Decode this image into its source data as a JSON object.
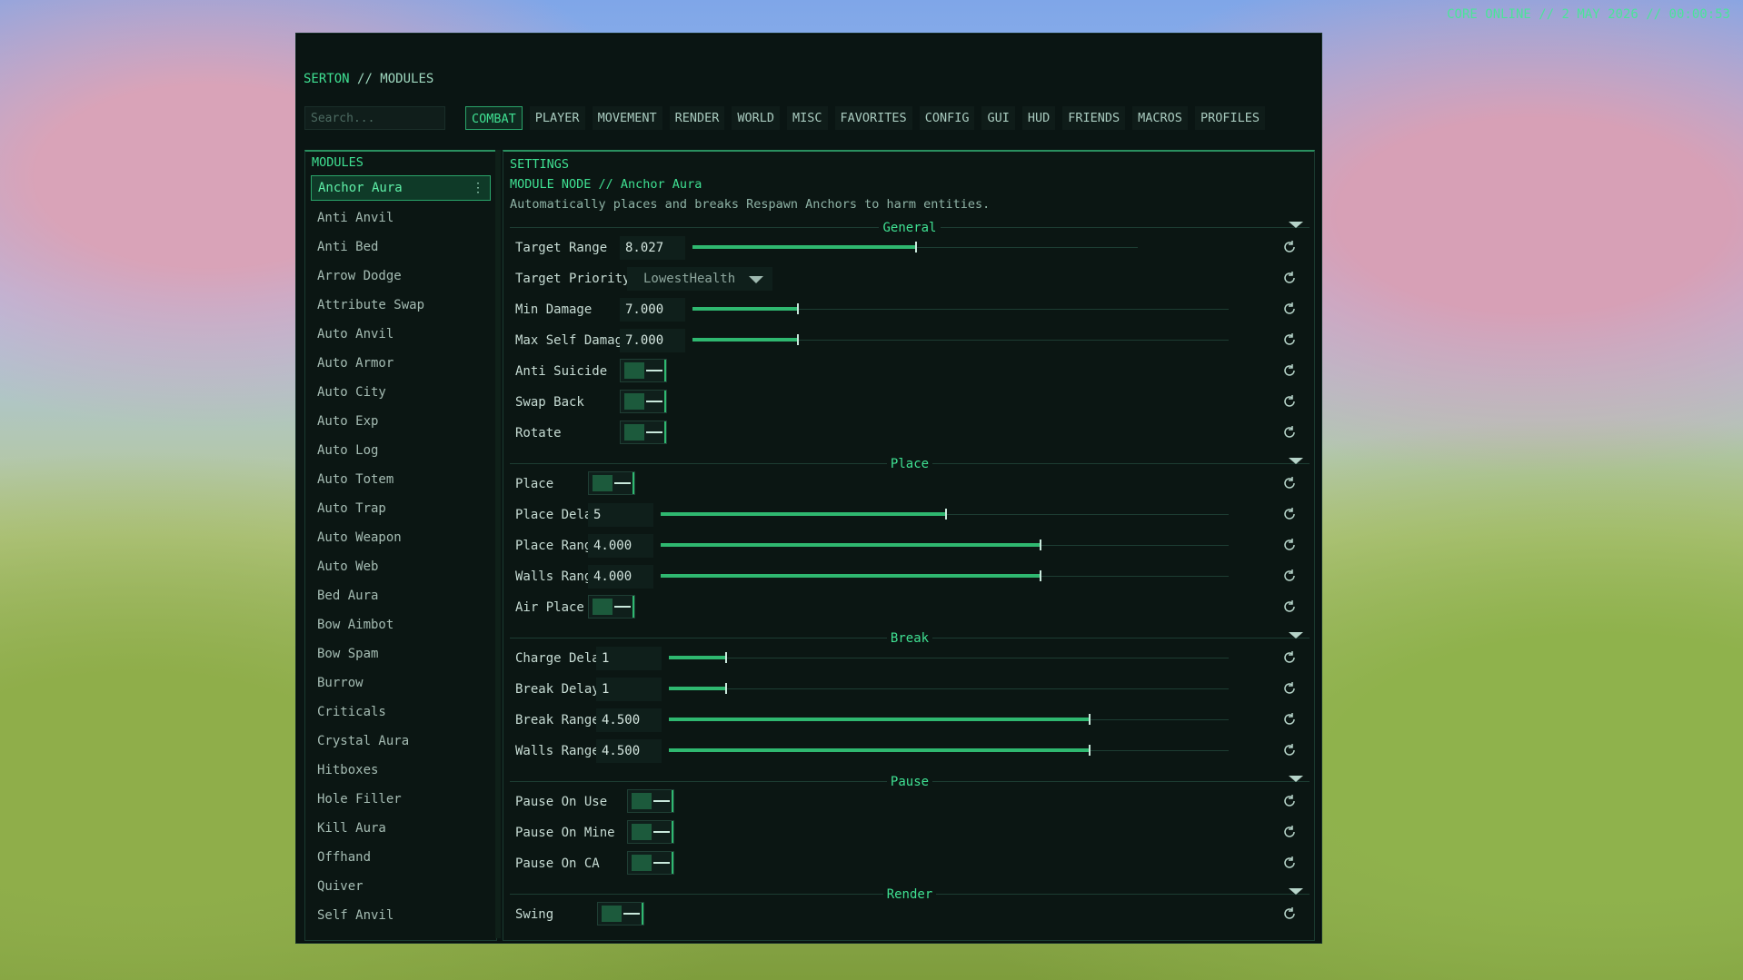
{
  "hud": {
    "status": "CORE ONLINE // 2 MAY 2026 // 00:00:53"
  },
  "window": {
    "brand": "SERTON",
    "title": "// MODULES"
  },
  "search": {
    "placeholder": "Search..."
  },
  "tabs": [
    "COMBAT",
    "PLAYER",
    "MOVEMENT",
    "RENDER",
    "WORLD",
    "MISC",
    "FAVORITES",
    "CONFIG",
    "GUI",
    "HUD",
    "FRIENDS",
    "MACROS",
    "PROFILES"
  ],
  "active_tab": "COMBAT",
  "modules": {
    "header": "MODULES",
    "items": [
      "Anchor Aura",
      "Anti Anvil",
      "Anti Bed",
      "Arrow Dodge",
      "Attribute Swap",
      "Auto Anvil",
      "Auto Armor",
      "Auto City",
      "Auto Exp",
      "Auto Log",
      "Auto Totem",
      "Auto Trap",
      "Auto Weapon",
      "Auto Web",
      "Bed Aura",
      "Bow Aimbot",
      "Bow Spam",
      "Burrow",
      "Criticals",
      "Crystal Aura",
      "Hitboxes",
      "Hole Filler",
      "Kill Aura",
      "Offhand",
      "Quiver",
      "Self Anvil"
    ],
    "more_icon": "⋮"
  },
  "settings": {
    "header": "SETTINGS",
    "node": "MODULE NODE // Anchor Aura",
    "description": "Automatically places and breaks Respawn Anchors to harm entities.",
    "sections": {
      "general": "General",
      "place": "Place",
      "break": "Break",
      "pause": "Pause",
      "render": "Render"
    },
    "general": {
      "target_range": {
        "label": "Target Range",
        "value": "8.027",
        "fraction": 0.5
      },
      "target_priority": {
        "label": "Target Priority",
        "value": "LowestHealth"
      },
      "min_damage": {
        "label": "Min Damage",
        "value": "7.000",
        "fraction": 0.195
      },
      "max_self_damage": {
        "label": "Max Self Damage",
        "value": "7.000",
        "fraction": 0.195
      },
      "anti_suicide": {
        "label": "Anti Suicide"
      },
      "swap_back": {
        "label": "Swap Back"
      },
      "rotate": {
        "label": "Rotate"
      }
    },
    "place": {
      "place": {
        "label": "Place"
      },
      "place_delay": {
        "label": "Place Delay",
        "value": "5",
        "fraction": 0.5
      },
      "place_range": {
        "label": "Place Range",
        "value": "4.000",
        "fraction": 0.667
      },
      "walls_range": {
        "label": "Walls Range",
        "value": "4.000",
        "fraction": 0.667
      },
      "air_place": {
        "label": "Air Place"
      }
    },
    "break": {
      "charge_delay": {
        "label": "Charge Delay",
        "value": "1",
        "fraction": 0.1
      },
      "break_delay": {
        "label": "Break Delay",
        "value": "1",
        "fraction": 0.1
      },
      "break_range": {
        "label": "Break Range",
        "value": "4.500",
        "fraction": 0.75
      },
      "walls_range": {
        "label": "Walls Range",
        "value": "4.500",
        "fraction": 0.75
      }
    },
    "pause": {
      "pause_on_use": {
        "label": "Pause On Use"
      },
      "pause_on_mine": {
        "label": "Pause On Mine"
      },
      "pause_on_ca": {
        "label": "Pause On CA"
      }
    },
    "render": {
      "swing": {
        "label": "Swing"
      }
    }
  },
  "colors": {
    "accent": "#3fe092",
    "panel": "#0b1613",
    "fill": "#2fb870"
  }
}
